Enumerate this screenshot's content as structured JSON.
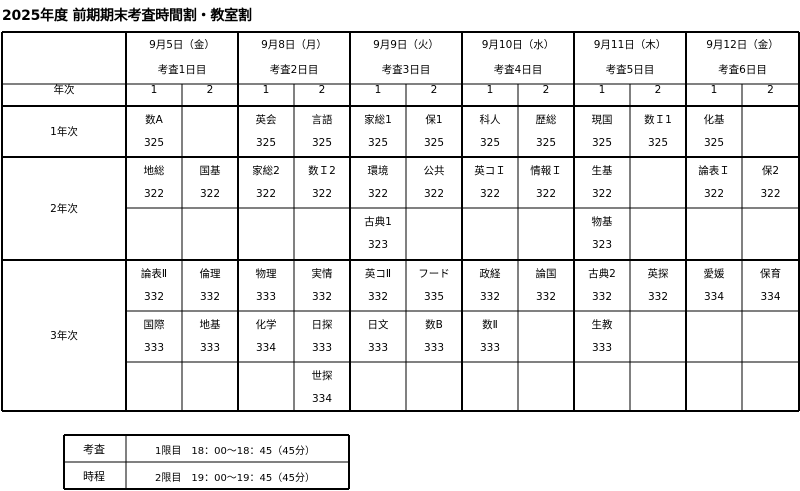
{
  "title": "2025年度 前期期末考査時間割・教室割",
  "row_header_label": "年次",
  "days": [
    {
      "date": "9月5日（金）",
      "label": "考査1日目"
    },
    {
      "date": "9月8日（月）",
      "label": "考査2日目"
    },
    {
      "date": "9月9日（火）",
      "label": "考査3日目"
    },
    {
      "date": "9月10日（水）",
      "label": "考査4日目"
    },
    {
      "date": "9月11日（木）",
      "label": "考査5日目"
    },
    {
      "date": "9月12日（金）",
      "label": "考査6日目"
    }
  ],
  "periods": [
    "1",
    "2",
    "1",
    "2",
    "1",
    "2",
    "1",
    "2",
    "1",
    "2",
    "1",
    "2"
  ],
  "grades": [
    {
      "label": "1年次",
      "rows": [
        [
          {
            "subject": "数A",
            "room": "325"
          },
          null,
          {
            "subject": "英会",
            "room": "325"
          },
          {
            "subject": "言語",
            "room": "325"
          },
          {
            "subject": "家総1",
            "room": "325"
          },
          {
            "subject": "保1",
            "room": "325"
          },
          {
            "subject": "科人",
            "room": "325"
          },
          {
            "subject": "歴総",
            "room": "325"
          },
          {
            "subject": "現国",
            "room": "325"
          },
          {
            "subject": "数Ｉ1",
            "room": "325"
          },
          {
            "subject": "化基",
            "room": "325"
          },
          null
        ]
      ]
    },
    {
      "label": "2年次",
      "rows": [
        [
          {
            "subject": "地総",
            "room": "322"
          },
          {
            "subject": "国基",
            "room": "322"
          },
          {
            "subject": "家総2",
            "room": "322"
          },
          {
            "subject": "数Ｉ2",
            "room": "322"
          },
          {
            "subject": "環境",
            "room": "322"
          },
          {
            "subject": "公共",
            "room": "322"
          },
          {
            "subject": "英コＩ",
            "room": "322"
          },
          {
            "subject": "情報Ｉ",
            "room": "322"
          },
          {
            "subject": "生基",
            "room": "322"
          },
          null,
          {
            "subject": "論表Ｉ",
            "room": "322"
          },
          {
            "subject": "保2",
            "room": "322"
          }
        ],
        [
          null,
          null,
          null,
          null,
          {
            "subject": "古典1",
            "room": "323"
          },
          null,
          null,
          null,
          {
            "subject": "物基",
            "room": "323"
          },
          null,
          null,
          null
        ]
      ]
    },
    {
      "label": "3年次",
      "rows": [
        [
          {
            "subject": "論表Ⅱ",
            "room": "332"
          },
          {
            "subject": "倫理",
            "room": "332"
          },
          {
            "subject": "物理",
            "room": "333"
          },
          {
            "subject": "実情",
            "room": "332"
          },
          {
            "subject": "英コⅡ",
            "room": "332"
          },
          {
            "subject": "フード",
            "room": "335"
          },
          {
            "subject": "政経",
            "room": "332"
          },
          {
            "subject": "論国",
            "room": "332"
          },
          {
            "subject": "古典2",
            "room": "332"
          },
          {
            "subject": "英探",
            "room": "332"
          },
          {
            "subject": "愛媛",
            "room": "334"
          },
          {
            "subject": "保育",
            "room": "334"
          }
        ],
        [
          {
            "subject": "国際",
            "room": "333"
          },
          {
            "subject": "地基",
            "room": "333"
          },
          {
            "subject": "化学",
            "room": "334"
          },
          {
            "subject": "日探",
            "room": "333"
          },
          {
            "subject": "日文",
            "room": "333"
          },
          {
            "subject": "数B",
            "room": "333"
          },
          {
            "subject": "数Ⅱ",
            "room": "333"
          },
          null,
          {
            "subject": "生教",
            "room": "333"
          },
          null,
          null,
          null
        ],
        [
          null,
          null,
          null,
          {
            "subject": "世探",
            "room": "334"
          },
          null,
          null,
          null,
          null,
          null,
          null,
          null,
          null
        ]
      ]
    }
  ],
  "schedule": {
    "label_line1": "考査",
    "label_line2": "時程",
    "periods": [
      "1限目　18：00～18：45（45分）",
      "2限目　19：00～19：45（45分）"
    ]
  }
}
